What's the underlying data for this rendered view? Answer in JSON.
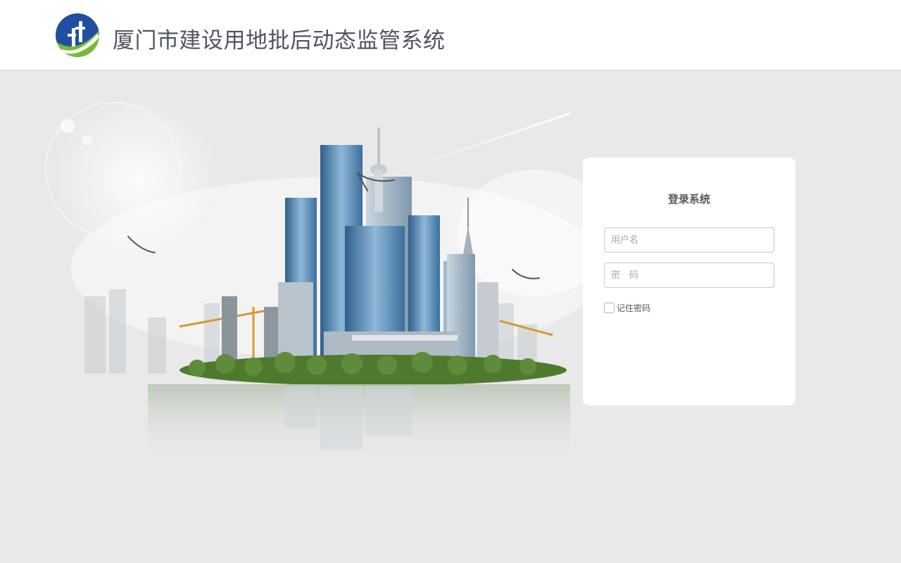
{
  "header": {
    "title": "厦门市建设用地批后动态监管系统",
    "logo_icon": "city-logo-icon",
    "colors": {
      "logo_blue": "#1f4fa0",
      "logo_green": "#7ab83a"
    }
  },
  "scene": {
    "image": "city-skyline-illustration"
  },
  "login": {
    "title": "登录系统",
    "username_placeholder": "用户名",
    "password_placeholder": "密　码",
    "remember_label": "记住密码"
  }
}
